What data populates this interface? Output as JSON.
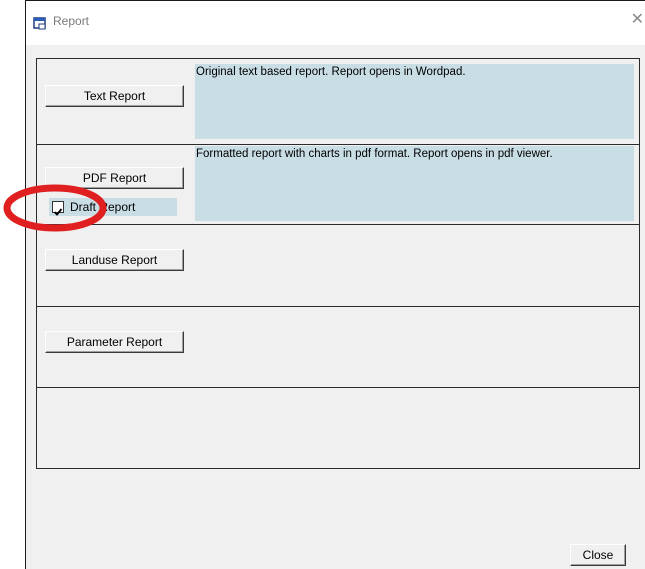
{
  "window": {
    "title": "Report",
    "close_glyph": "✕"
  },
  "sections": [
    {
      "button_label": "Text Report",
      "description": "Original text based report. Report opens in Wordpad."
    },
    {
      "button_label": "PDF Report",
      "description": "Formatted report with charts in pdf format. Report opens in pdf viewer.",
      "checkbox": {
        "label": "Draft Report",
        "checked": true,
        "check_glyph": "✔"
      }
    },
    {
      "button_label": "Landuse Report"
    },
    {
      "button_label": "Parameter Report"
    }
  ],
  "footer": {
    "close_label": "Close"
  },
  "colors": {
    "description_bg": "#c9dde5",
    "window_bg": "#f0f0f0",
    "annotation_circle": "#e02020"
  }
}
